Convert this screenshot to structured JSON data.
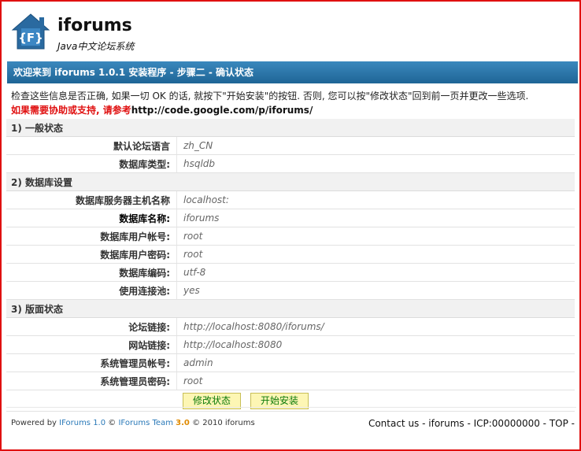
{
  "brand": {
    "name": "iforums",
    "tagline": "Java中文论坛系统",
    "logo_letter": "{F}"
  },
  "title_bar": "欢迎来到 iforums 1.0.1 安装程序 - 步骤二 - 确认状态",
  "intro": {
    "instructions": "检查这些信息是否正确, 如果一切 OK 的话, 就按下\"开始安装\"的按钮. 否则, 您可以按\"修改状态\"回到前一页并更改一些选项.",
    "help_prefix": "如果需要协助或支持, 请参考",
    "help_url": "http://code.google.com/p/iforums/"
  },
  "sections": [
    {
      "title": "1) 一般状态",
      "rows": [
        {
          "label": "默认论坛语言",
          "value": "zh_CN"
        },
        {
          "label": "数据库类型:",
          "value": "hsqldb"
        }
      ]
    },
    {
      "title": "2) 数据库设置",
      "rows": [
        {
          "label": "数据库服务器主机名称",
          "value": "localhost:"
        },
        {
          "label": "数据库名称:",
          "value": "iforums"
        },
        {
          "label": "数据库用户帐号:",
          "value": "root"
        },
        {
          "label": "数据库用户密码:",
          "value": "root"
        },
        {
          "label": "数据库编码:",
          "value": "utf-8"
        },
        {
          "label": "使用连接池:",
          "value": "yes"
        }
      ]
    },
    {
      "title": "3) 版面状态",
      "rows": [
        {
          "label": "论坛链接:",
          "value": "http://localhost:8080/iforums/"
        },
        {
          "label": "网站链接:",
          "value": "http://localhost:8080"
        },
        {
          "label": "系统管理员帐号:",
          "value": "admin"
        },
        {
          "label": "系统管理员密码:",
          "value": "root"
        }
      ]
    }
  ],
  "buttons": {
    "modify": "修改状态",
    "install": "开始安装"
  },
  "footer": {
    "powered_by": "Powered by",
    "product": "IForums 1.0",
    "copy1": "©",
    "team": "IForums Team",
    "version": "3.0",
    "copy2": "© 2010 iforums",
    "links": "Contact us - iforums - ICP:00000000 - TOP -"
  },
  "colors": {
    "frame": "#e01010",
    "title_bar": "#2672a8",
    "button_bg": "#fdf6b4",
    "button_text": "#0a7a0a"
  }
}
